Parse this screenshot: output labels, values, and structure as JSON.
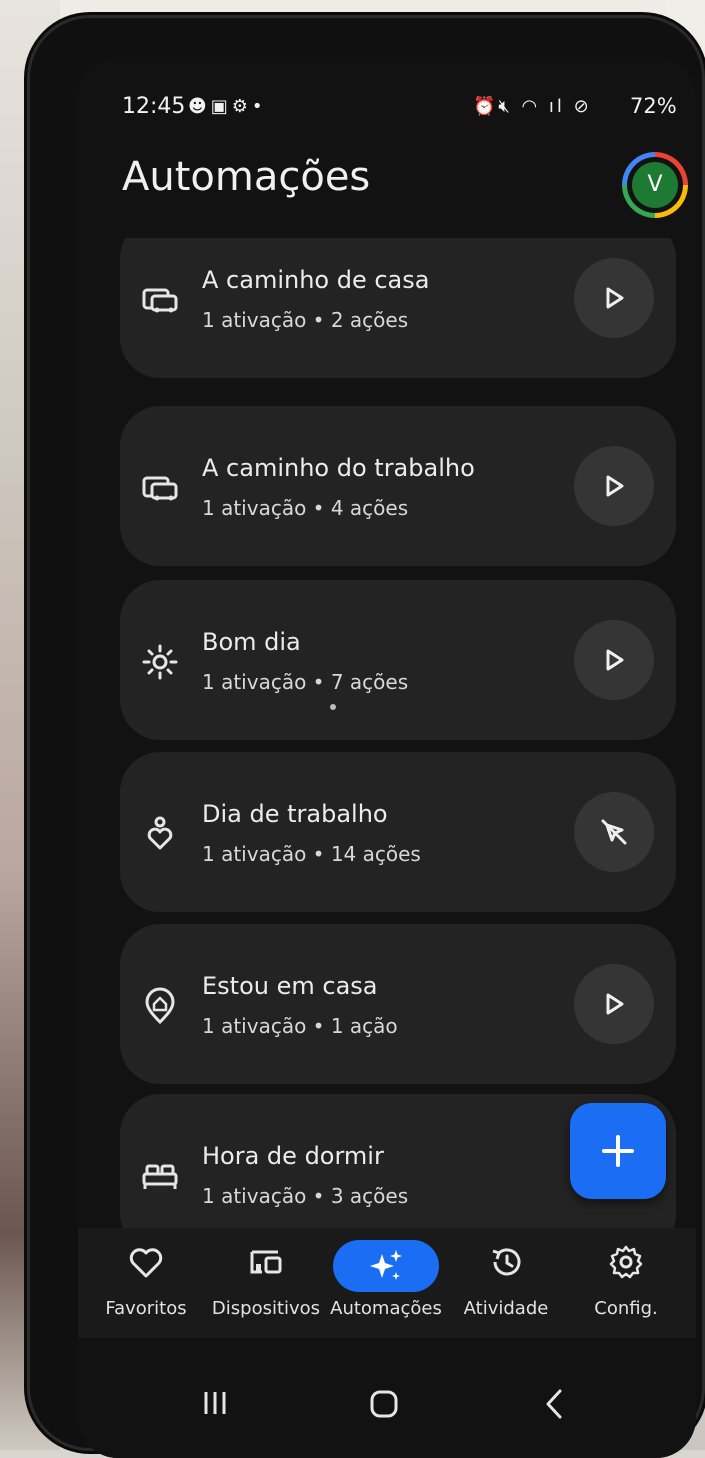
{
  "status_bar": {
    "time": "12:45",
    "battery": "72%"
  },
  "header": {
    "title": "Automações",
    "avatar_letter": "V"
  },
  "automations": [
    {
      "name": "A caminho de casa",
      "meta": "1 ativação • 2 ações",
      "icon": "car-icon",
      "action": "play-icon"
    },
    {
      "name": "A caminho do trabalho",
      "meta": "1 ativação • 4 ações",
      "icon": "car-icon",
      "action": "play-icon"
    },
    {
      "name": "Bom dia",
      "meta": "1 ativação • 7 ações",
      "icon": "sun-icon",
      "action": "play-icon"
    },
    {
      "name": "Dia de trabalho",
      "meta": "1 ativação • 14 ações",
      "icon": "heart-person-icon",
      "action": "touch-disabled-icon"
    },
    {
      "name": "Estou em casa",
      "meta": "1 ativação • 1 ação",
      "icon": "location-home-icon",
      "action": "play-icon"
    },
    {
      "name": "Hora de dormir",
      "meta": "1 ativação • 3 ações",
      "icon": "bed-icon",
      "action": "play-icon"
    }
  ],
  "fab": {
    "icon": "plus-icon"
  },
  "bottom_nav": [
    {
      "label": "Favoritos",
      "icon": "heart-outline-icon"
    },
    {
      "label": "Dispositivos",
      "icon": "devices-icon"
    },
    {
      "label": "Automações",
      "icon": "sparkle-icon",
      "active": true
    },
    {
      "label": "Atividade",
      "icon": "history-icon"
    },
    {
      "label": "Config.",
      "icon": "gear-icon"
    }
  ],
  "colors": {
    "accent": "#1b6ef3",
    "background": "#121212",
    "card": "#232323"
  }
}
